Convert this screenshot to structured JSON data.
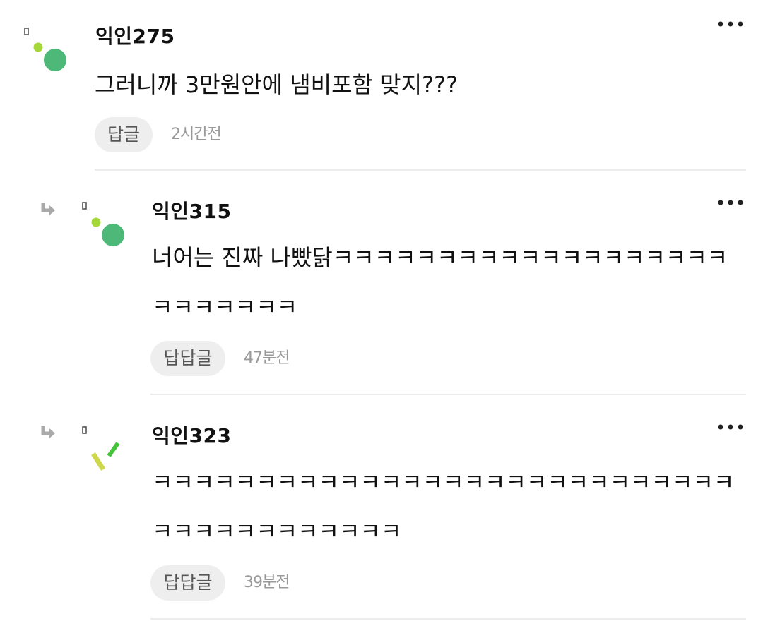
{
  "comments": [
    {
      "author": "익인275",
      "text": "그러니까 3만원안에 냄비포함 맞지???",
      "reply_label": "답글",
      "time": "2시간전",
      "is_reply": false,
      "avatar_icon": "green-dots-avatar-icon",
      "more_icon": "more-options-icon"
    },
    {
      "author": "익인315",
      "text": "너어는 진짜 나빴닭ㅋㅋㅋㅋㅋㅋㅋㅋㅋㅋㅋㅋㅋㅋㅋㅋㅋㅋㅋㅋㅋㅋㅋㅋㅋㅋ",
      "reply_label": "답답글",
      "time": "47분전",
      "is_reply": true,
      "avatar_icon": "green-dots-avatar-icon",
      "more_icon": "more-options-icon"
    },
    {
      "author": "익인323",
      "text": "ㅋㅋㅋㅋㅋㅋㅋㅋㅋㅋㅋㅋㅋㅋㅋㅋㅋㅋㅋㅋㅋㅋㅋㅋㅋㅋㅋㅋㅋㅋㅋㅋㅋㅋㅋㅋㅋㅋㅋㅋ",
      "reply_label": "답답글",
      "time": "39분전",
      "is_reply": true,
      "avatar_icon": "yellow-green-dashes-avatar-icon",
      "more_icon": "more-options-icon"
    }
  ],
  "colors": {
    "avatar_green": "#4db877",
    "avatar_lime": "#a5d63a",
    "avatar_yellow": "#cfd84a",
    "avatar_dash_green": "#45c43b",
    "reply_button_bg": "#eeeeee",
    "divider": "#ececec"
  }
}
